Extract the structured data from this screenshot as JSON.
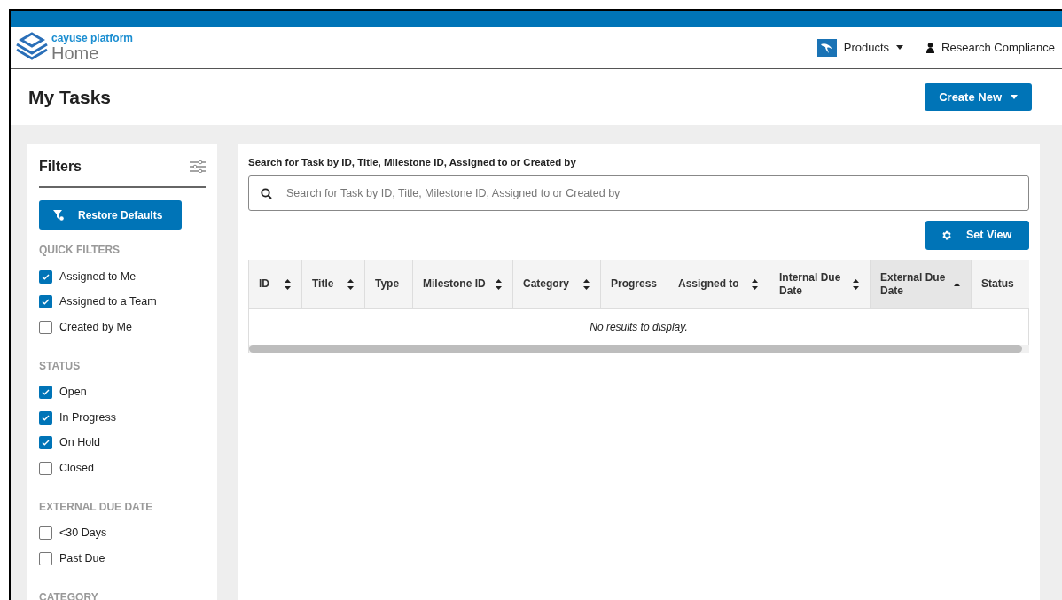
{
  "brand": {
    "name": "cayuse platform",
    "section": "Home"
  },
  "nav": [
    {
      "kind": "products",
      "label": "Products"
    },
    {
      "kind": "user",
      "label": "Research Compliance"
    }
  ],
  "page": {
    "title": "My Tasks",
    "create_button": "Create New"
  },
  "filters": {
    "title": "Filters",
    "restore_button": "Restore Defaults",
    "groups": [
      {
        "title": "QUICK FILTERS",
        "items": [
          {
            "label": "Assigned to Me",
            "checked": true
          },
          {
            "label": "Assigned to a Team",
            "checked": true
          },
          {
            "label": "Created by Me",
            "checked": false
          }
        ]
      },
      {
        "title": "STATUS",
        "items": [
          {
            "label": "Open",
            "checked": true
          },
          {
            "label": "In Progress",
            "checked": true
          },
          {
            "label": "On Hold",
            "checked": true
          },
          {
            "label": "Closed",
            "checked": false
          }
        ]
      },
      {
        "title": "EXTERNAL DUE DATE",
        "items": [
          {
            "label": "<30 Days",
            "checked": false
          },
          {
            "label": "Past Due",
            "checked": false
          }
        ]
      },
      {
        "title": "CATEGORY"
      }
    ]
  },
  "search": {
    "label": "Search for Task by ID, Title, Milestone ID, Assigned to or Created by",
    "placeholder": "Search for Task by ID, Title, Milestone ID, Assigned to or Created by"
  },
  "set_view_button": "Set View",
  "table": {
    "columns": [
      {
        "label": "ID",
        "sortable": true,
        "sorted_ascending": false
      },
      {
        "label": "Title",
        "sortable": true,
        "sorted_ascending": false
      },
      {
        "label": "Type",
        "sortable": false,
        "sorted_ascending": false
      },
      {
        "label": "Milestone ID",
        "sortable": true,
        "sorted_ascending": false
      },
      {
        "label": "Category",
        "sortable": true,
        "sorted_ascending": false
      },
      {
        "label": "Progress",
        "sortable": false,
        "sorted_ascending": false
      },
      {
        "label": "Assigned to",
        "sortable": true,
        "sorted_ascending": false
      },
      {
        "label": "Internal Due Date",
        "sortable": true,
        "sorted_ascending": false
      },
      {
        "label": "External Due Date",
        "sortable": true,
        "sorted_ascending": true
      },
      {
        "label": "Status",
        "sortable": false,
        "sorted_ascending": false
      }
    ],
    "empty_message": "No results to display."
  }
}
